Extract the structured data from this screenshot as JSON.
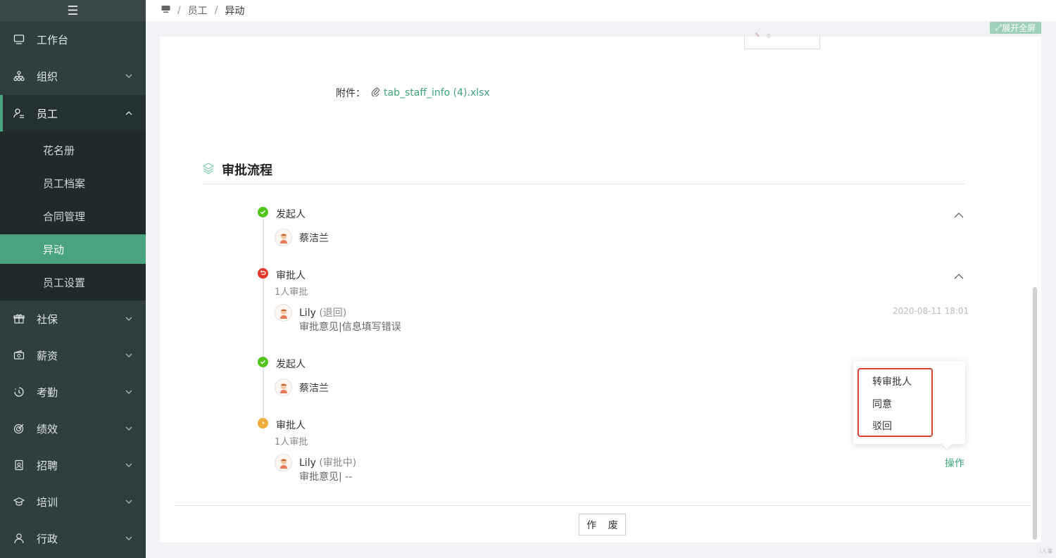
{
  "sidebar": {
    "toggle_icon": "hamburger-icon",
    "menu": [
      {
        "label": "工作台",
        "icon": "monitor-icon"
      },
      {
        "label": "组织",
        "icon": "org-chart-icon"
      },
      {
        "label": "员工",
        "icon": "user-list-icon"
      },
      {
        "label": "社保",
        "icon": "gift-icon"
      },
      {
        "label": "薪资",
        "icon": "wallet-icon"
      },
      {
        "label": "考勤",
        "icon": "clock-icon"
      },
      {
        "label": "绩效",
        "icon": "target-icon"
      },
      {
        "label": "招聘",
        "icon": "badge-icon"
      },
      {
        "label": "培训",
        "icon": "graduation-icon"
      },
      {
        "label": "行政",
        "icon": "person-icon"
      }
    ],
    "submenu": [
      {
        "label": "花名册"
      },
      {
        "label": "员工档案"
      },
      {
        "label": "合同管理"
      },
      {
        "label": "异动"
      },
      {
        "label": "员工设置"
      }
    ],
    "accent_color": "#4aa37f"
  },
  "header": {
    "home_icon": "monitor-icon",
    "breadcrumb": [
      "员工",
      "异动"
    ]
  },
  "fullscreen_label": "展开全屏",
  "attachment": {
    "label": "附件：",
    "file_name": "tab_staff_info (4).xlsx"
  },
  "approval": {
    "title": "审批流程",
    "nodes": [
      {
        "title": "发起人",
        "status": "done",
        "color": "#52c41a",
        "person": "蔡洁兰"
      },
      {
        "title": "审批人",
        "status": "returned",
        "color": "#e0382b",
        "count": "1人审批",
        "person": "Lily",
        "person_status": "(退回)",
        "opinion": "审批意见|信息填写错误",
        "time": "2020-08-11 18:01"
      },
      {
        "title": "发起人",
        "status": "done",
        "color": "#52c41a",
        "person": "蔡洁兰"
      },
      {
        "title": "审批人",
        "status": "pending",
        "color": "#f0ad3a",
        "count": "1人审批",
        "person": "Lily",
        "person_status": "(审批中)",
        "opinion": "审批意见| --"
      }
    ],
    "action_link": "操作",
    "popover_items": [
      "转审批人",
      "同意",
      "驳回"
    ]
  },
  "void_button": "作 废",
  "corner_text": "i人事"
}
